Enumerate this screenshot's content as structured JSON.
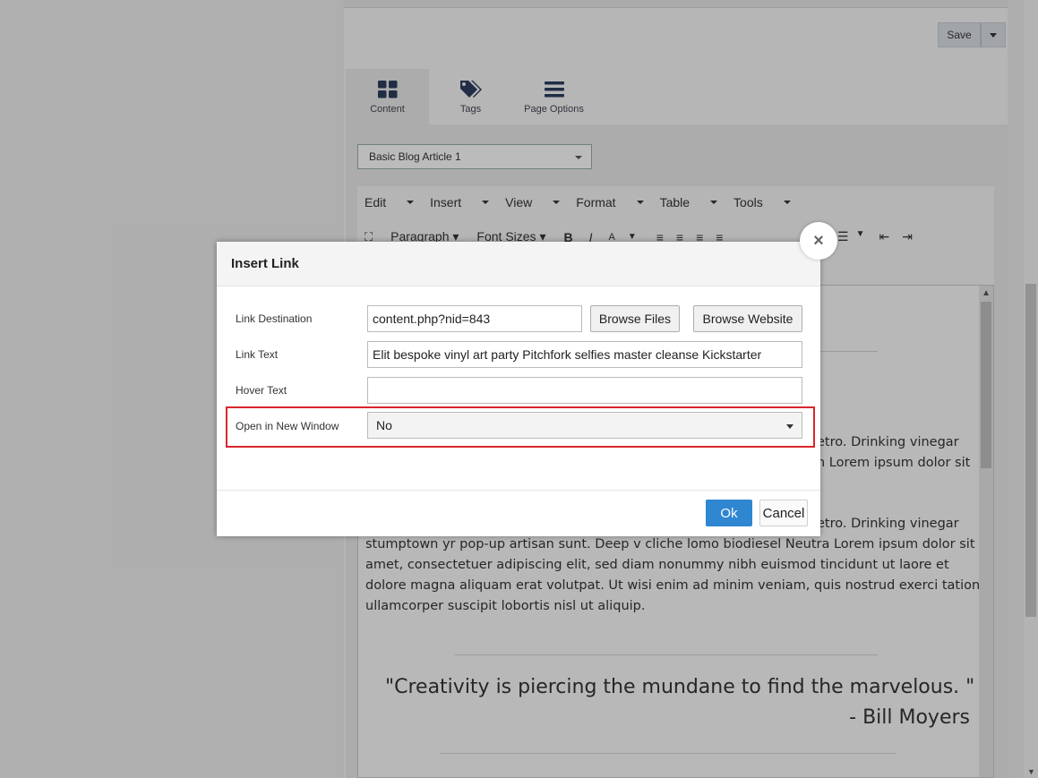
{
  "toolbar": {
    "save_label": "Save"
  },
  "tabs": [
    {
      "label": "Content",
      "icon": "grid-icon"
    },
    {
      "label": "Tags",
      "icon": "tags-icon"
    },
    {
      "label": "Page Options",
      "icon": "menu-icon"
    }
  ],
  "template_select": {
    "value": "Basic Blog Article 1"
  },
  "editor": {
    "menus": [
      "Edit",
      "Insert",
      "View",
      "Format",
      "Table",
      "Tools"
    ],
    "format_labels": {
      "paragraph": "Paragraph",
      "font_sizes": "Font Sizes",
      "bold": "B",
      "italic": "I",
      "font_color": "A"
    },
    "paragraph_fragments": {
      "line1_tail": "etro. Drinking vinegar",
      "line2_tail": "n Lorem ipsum dolor sit",
      "line3_tail": "etro. Drinking vinegar"
    },
    "paragraph2_lines": [
      "stumptown yr pop-up artisan sunt. Deep v cliche lomo biodiesel Neutra Lorem ipsum dolor sit",
      "amet, consectetuer adipiscing elit, sed diam nonummy nibh euismod tincidunt ut laore et",
      "dolore magna aliquam erat volutpat. Ut wisi enim ad minim veniam, quis nostrud exerci tation",
      "ullamcorper suscipit lobortis nisl ut aliquip."
    ],
    "quote_text": "\"Creativity is piercing the mundane to find the marvelous. \"",
    "quote_author": "- Bill Moyers"
  },
  "modal": {
    "title": "Insert Link",
    "fields": {
      "link_destination": {
        "label": "Link Destination",
        "value": "content.php?nid=843"
      },
      "link_text": {
        "label": "Link Text",
        "value": "Elit bespoke vinyl art party Pitchfork selfies master cleanse Kickstarter"
      },
      "hover_text": {
        "label": "Hover Text",
        "value": ""
      },
      "open_new_window": {
        "label": "Open in New Window",
        "value": "No"
      }
    },
    "browse_files_label": "Browse Files",
    "browse_website_label": "Browse Website",
    "ok_label": "Ok",
    "cancel_label": "Cancel",
    "close_symbol": "×"
  },
  "colors": {
    "primary": "#2f86d1",
    "highlight": "#d9262c"
  }
}
